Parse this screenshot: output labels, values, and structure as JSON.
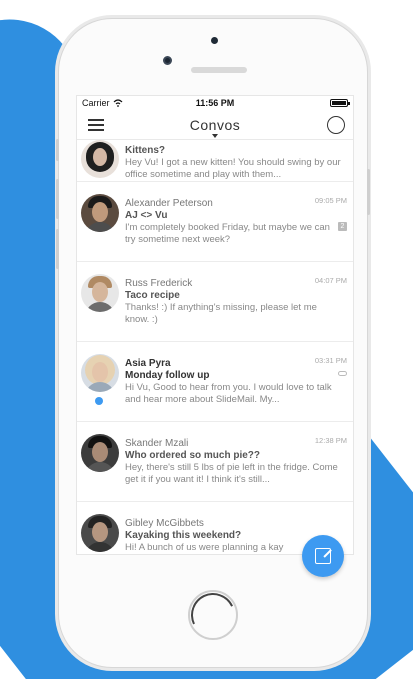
{
  "status": {
    "carrier": "Carrier",
    "time": "11:56 PM"
  },
  "nav": {
    "title": "Convos"
  },
  "conversations": [
    {
      "name": "",
      "subject": "Kittens?",
      "preview": "Hey Vu! I got a new kitten! You should swing by our office sometime and play with them...",
      "time": "",
      "unread": false
    },
    {
      "name": "Alexander Peterson",
      "subject": "AJ <> Vu",
      "preview": "I'm completely booked Friday, but maybe we can try sometime next week?",
      "time": "09:05 PM",
      "badge": "2",
      "unread": false
    },
    {
      "name": "Russ Frederick",
      "subject": "Taco recipe",
      "preview": "Thanks! :) If anything's missing, please let me know. :)",
      "time": "04:07 PM",
      "unread": false
    },
    {
      "name": "Asia Pyra",
      "subject": "Monday follow up",
      "preview": "Hi Vu, Good to hear from you. I would love to talk and hear more about SlideMail. My...",
      "time": "03:31 PM",
      "unread": true
    },
    {
      "name": "Skander Mzali",
      "subject": "Who ordered so much pie??",
      "preview": "Hey, there's still 5 lbs of pie left in the fridge. Come get it if you want it! I think it's still...",
      "time": "12:38 PM",
      "unread": false
    },
    {
      "name": "Gibley McGibbets",
      "subject": "Kayaking this weekend?",
      "preview": "Hi! A bunch of us were planning a kay",
      "time": "",
      "unread": false
    }
  ],
  "colors": {
    "accent": "#3d9af1",
    "background": "#2f8fe0"
  }
}
